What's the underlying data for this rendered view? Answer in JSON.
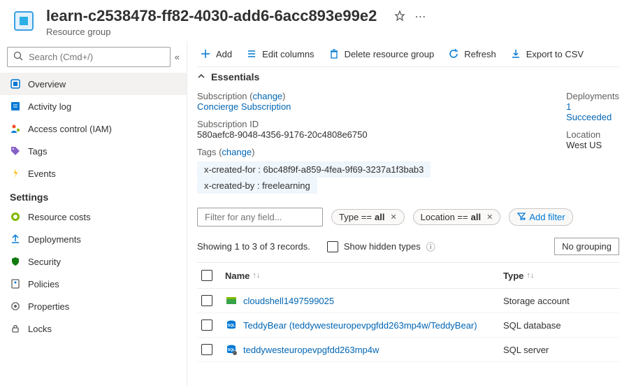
{
  "header": {
    "title": "learn-c2538478-ff82-4030-add6-6acc893e99e2",
    "subtitle": "Resource group"
  },
  "search": {
    "placeholder": "Search (Cmd+/)"
  },
  "sidebar": {
    "items": [
      {
        "label": "Overview"
      },
      {
        "label": "Activity log"
      },
      {
        "label": "Access control (IAM)"
      },
      {
        "label": "Tags"
      },
      {
        "label": "Events"
      }
    ],
    "settings_header": "Settings",
    "settings": [
      {
        "label": "Resource costs"
      },
      {
        "label": "Deployments"
      },
      {
        "label": "Security"
      },
      {
        "label": "Policies"
      },
      {
        "label": "Properties"
      },
      {
        "label": "Locks"
      }
    ]
  },
  "toolbar": {
    "add": "Add",
    "edit_columns": "Edit columns",
    "delete": "Delete resource group",
    "refresh": "Refresh",
    "export": "Export to CSV"
  },
  "essentials": {
    "header": "Essentials",
    "subscription_label": "Subscription",
    "subscription_change": "change",
    "subscription_name": "Concierge Subscription",
    "subscription_id_label": "Subscription ID",
    "subscription_id": "580aefc8-9048-4356-9176-20c4808e6750",
    "tags_label": "Tags",
    "tags_change": "change",
    "tag1": "x-created-for : 6bc48f9f-a859-4fea-9f69-3237a1f3bab3",
    "tag2": "x-created-by : freelearning",
    "deployments_label": "Deployments",
    "deployments_value": "1 Succeeded",
    "location_label": "Location",
    "location_value": "West US"
  },
  "filter": {
    "placeholder": "Filter for any field...",
    "type_pill_prefix": "Type == ",
    "type_pill_value": "all",
    "loc_pill_prefix": "Location == ",
    "loc_pill_value": "all",
    "add_filter": "Add filter"
  },
  "records": {
    "status": "Showing 1 to 3 of 3 records.",
    "show_hidden": "Show hidden types",
    "grouping": "No grouping"
  },
  "table": {
    "col_name": "Name",
    "col_type": "Type",
    "rows": [
      {
        "name": "cloudshell1497599025",
        "type": "Storage account"
      },
      {
        "name": "TeddyBear (teddywesteuropevpgfdd263mp4w/TeddyBear)",
        "type": "SQL database"
      },
      {
        "name": "teddywesteuropevpgfdd263mp4w",
        "type": "SQL server"
      }
    ]
  }
}
